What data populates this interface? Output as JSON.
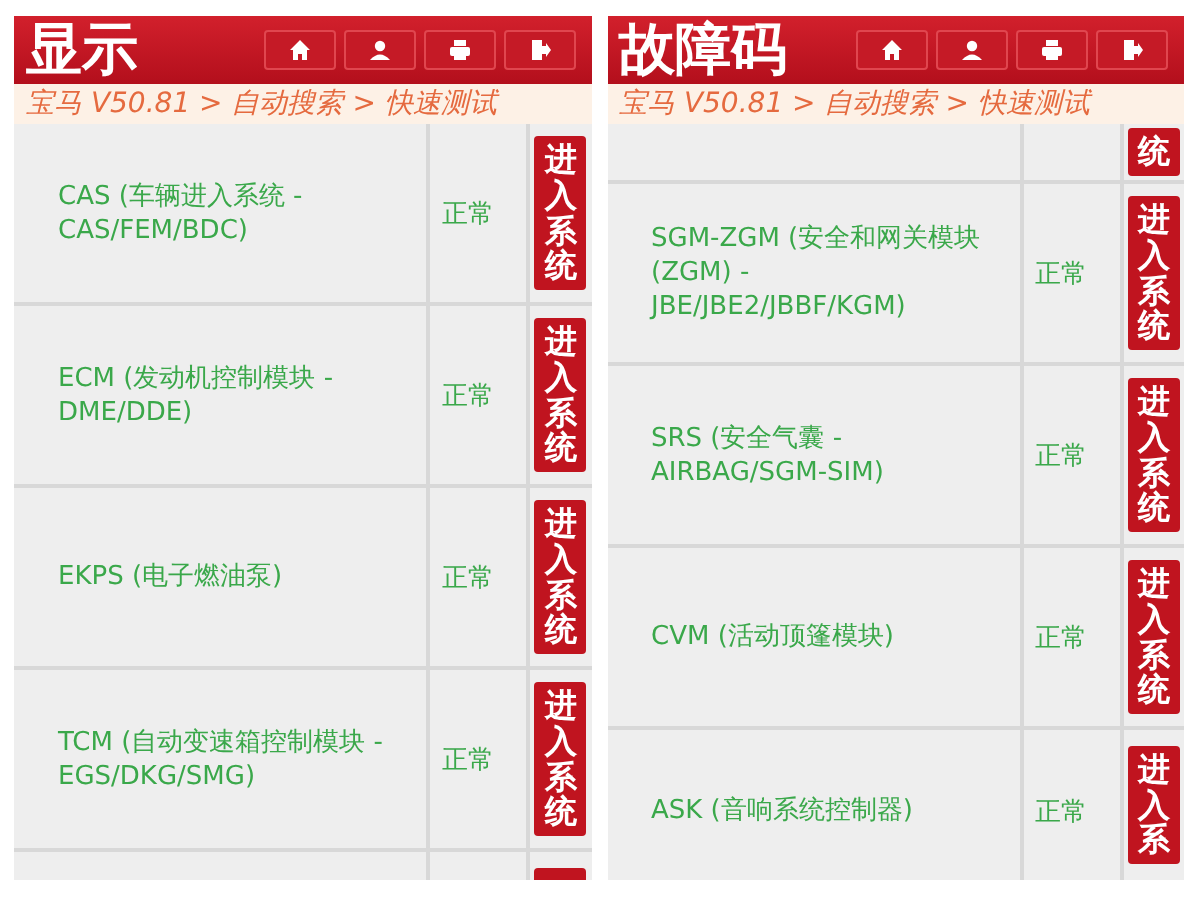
{
  "panels": [
    {
      "title": "显示",
      "breadcrumb": "宝马 V50.81 > 自动搜索 > 快速测试",
      "rows": [
        {
          "kind": "row",
          "name": "CAS (车辆进入系统 - CAS/FEM/BDC)",
          "status": "正常",
          "button": "进入系统"
        },
        {
          "kind": "row",
          "name": "ECM (发动机控制模块 - DME/DDE)",
          "status": "正常",
          "button": "进入系统"
        },
        {
          "kind": "row",
          "name": "EKPS (电子燃油泵)",
          "status": "正常",
          "button": "进入系统"
        },
        {
          "kind": "row",
          "name": "TCM (自动变速箱控制模块 - EGS/DKG/SMG)",
          "status": "正常",
          "button": "进入系统"
        },
        {
          "kind": "clipped-bottom"
        }
      ]
    },
    {
      "title": "故障码",
      "breadcrumb": "宝马 V50.81 > 自动搜索 > 快速测试",
      "rows": [
        {
          "kind": "clipped-top",
          "button": "统"
        },
        {
          "kind": "row",
          "name": "SGM-ZGM (安全和网关模块 (ZGM) - JBE/JBE2/JBBF/KGM)",
          "status": "正常",
          "button": "进入系统"
        },
        {
          "kind": "row",
          "name": "SRS (安全气囊 - AIRBAG/SGM-SIM)",
          "status": "正常",
          "button": "进入系统"
        },
        {
          "kind": "row",
          "name": "CVM (活动顶篷模块)",
          "status": "正常",
          "button": "进入系统"
        },
        {
          "kind": "clipped-bottom",
          "name": "ASK (音响系统控制器)",
          "status": "正常",
          "button": "进入系"
        }
      ]
    }
  ]
}
